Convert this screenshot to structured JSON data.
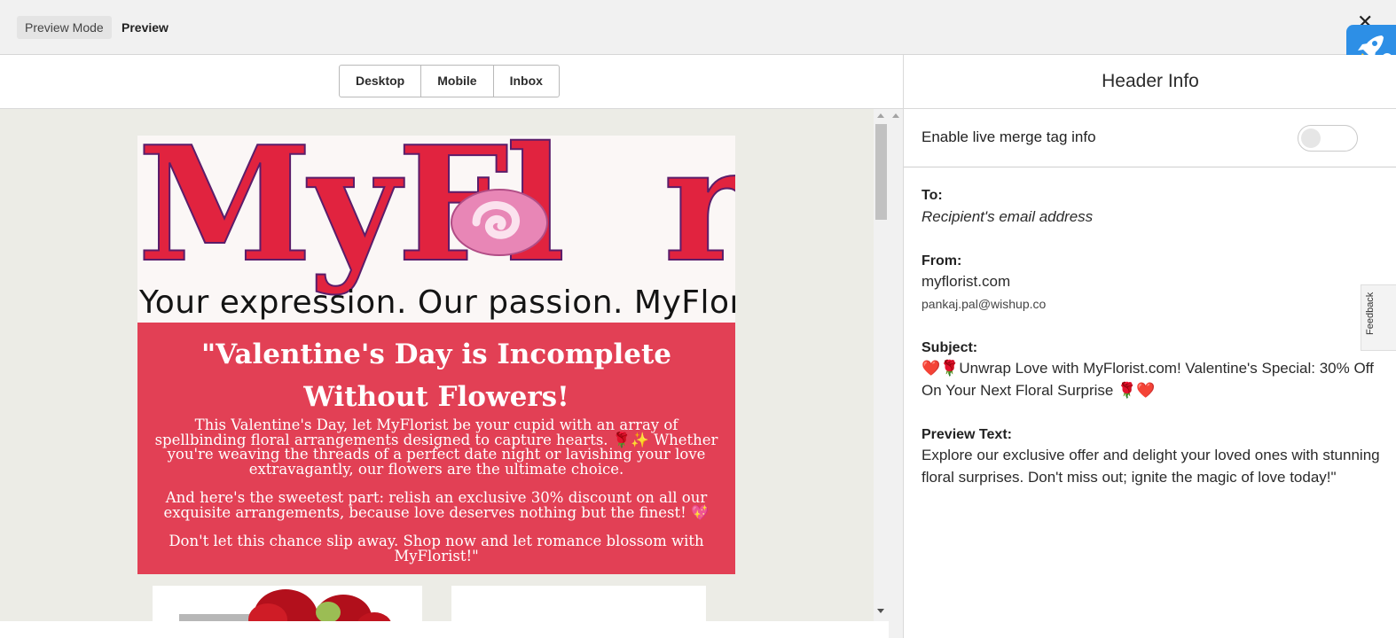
{
  "topbar": {
    "mode_pill": "Preview Mode",
    "title": "Preview",
    "close_glyph": "✕"
  },
  "device_tabs": [
    {
      "label": "Desktop"
    },
    {
      "label": "Mobile"
    },
    {
      "label": "Inbox"
    }
  ],
  "email": {
    "logo_text": "MyFlorist",
    "tagline": "Your expression. Our passion. MyFlorist.",
    "hero_title": "\"Valentine's Day is Incomplete Without Flowers!",
    "paragraph1": "This Valentine's Day, let MyFlorist be your cupid with an array of spellbinding floral arrangements designed to capture hearts. 🌹✨ Whether you're weaving the threads of a perfect date night or lavishing your love extravagantly, our flowers are the ultimate choice.",
    "paragraph2": "And here's the sweetest part: relish an exclusive 30% discount on all our exquisite arrangements, because love deserves nothing but the finest! 💖",
    "paragraph3": "Don't let this chance slip away. Shop now and let romance blossom with MyFlorist!\""
  },
  "header_info": {
    "title": "Header Info",
    "merge_toggle_label": "Enable live merge tag info",
    "merge_toggle_on": false,
    "to_label": "To:",
    "to_value": "Recipient's email address",
    "from_label": "From:",
    "from_name": "myflorist.com",
    "from_email": "pankaj.pal@wishup.co",
    "subject_label": "Subject:",
    "subject_value": "❤️🌹Unwrap Love with MyFlorist.com! Valentine's Special: 30% Off On Your Next Floral Surprise 🌹❤️",
    "preview_label": "Preview Text:",
    "preview_value": "Explore our exclusive offer and delight your loved ones with stunning floral surprises. Don't miss out; ignite the magic of love today!\""
  },
  "feedback_tab": "Feedback",
  "colors": {
    "hero_bg": "#e24055",
    "logo_red": "#e1233f",
    "canvas_bg": "#ecece6",
    "rocket_bg": "#2d8fe6"
  }
}
